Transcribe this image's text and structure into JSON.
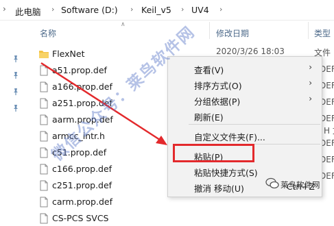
{
  "breadcrumb": {
    "segments": [
      "此电脑",
      "Software (D:)",
      "Keil_v5",
      "UV4"
    ]
  },
  "columns": {
    "name": "名称",
    "date": "修改日期",
    "type": "类型"
  },
  "files": [
    {
      "name": "FlexNet",
      "kind": "folder"
    },
    {
      "name": "a51.prop.def",
      "kind": "file"
    },
    {
      "name": "a166.prop.def",
      "kind": "file"
    },
    {
      "name": "a251.prop.def",
      "kind": "file"
    },
    {
      "name": "aarm.prop.def",
      "kind": "file"
    },
    {
      "name": "armcc_intr.h",
      "kind": "file"
    },
    {
      "name": "c51.prop.def",
      "kind": "file"
    },
    {
      "name": "c166.prop.def",
      "kind": "file"
    },
    {
      "name": "c251.prop.def",
      "kind": "file"
    },
    {
      "name": "carm.prop.def",
      "kind": "file"
    },
    {
      "name": "CS-PCS SVCS",
      "kind": "file"
    }
  ],
  "side_text": {
    "flexnet_date": "2020/3/26 18:03",
    "flexnet_type": "文件",
    "type_def1": "DEF 文",
    "type_def2": "DEF 文",
    "type_def3": "DEF 文",
    "type_def4": "DEF 文",
    "type_h": "H 文",
    "type_def5": "DEF 文",
    "type_def6": "DEF 文",
    "type_def7": "DEF 文",
    "type_def8": "DEF 文"
  },
  "context_menu": {
    "items": [
      {
        "label": "查看(V)",
        "submenu": true
      },
      {
        "label": "排序方式(O)",
        "submenu": true
      },
      {
        "label": "分组依据(P)",
        "submenu": true
      },
      {
        "label": "刷新(E)",
        "submenu": false
      },
      {
        "label": "自定义文件夹(F)...",
        "submenu": false
      },
      {
        "label": "粘贴(P)",
        "submenu": false
      },
      {
        "label": "粘贴快捷方式(S)",
        "submenu": false
      },
      {
        "label": "撤消 移动(U)",
        "submenu": false,
        "shortcut": "Ctrl+Z"
      }
    ],
    "highlighted": "粘贴(P)"
  },
  "overlay": {
    "watermark": "微信公众号：莱鸟软件网",
    "brand": "莱鸟软件网"
  },
  "colors": {
    "highlight_box": "#e3292c",
    "arrow": "#e3292c",
    "folder": "#f3c243",
    "header_text": "#4d6a8a"
  }
}
